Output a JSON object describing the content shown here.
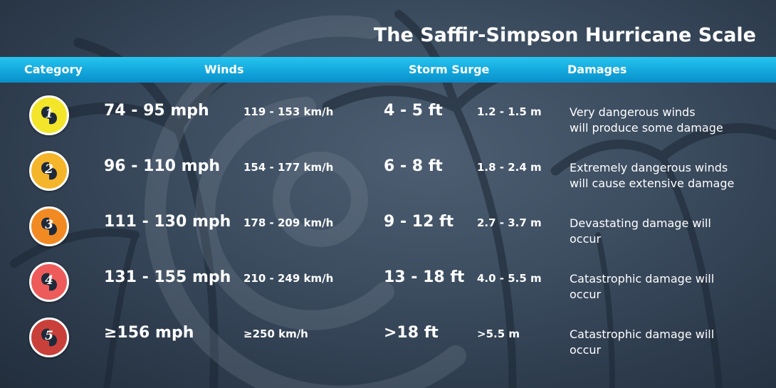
{
  "title": "The Saffir-Simpson Hurricane Scale",
  "headers": {
    "category": "Category",
    "winds": "Winds",
    "storm_surge": "Storm Surge",
    "damages": "Damages"
  },
  "rows": [
    {
      "category": "1",
      "badge_color": "#f3e62a",
      "winds_mph": "74 - 95 mph",
      "winds_kmh": "119 - 153 km/h",
      "surge_ft": "4 - 5 ft",
      "surge_m": "1.2 - 1.5 m",
      "damage_line1": "Very dangerous winds",
      "damage_line2": "will produce some damage"
    },
    {
      "category": "2",
      "badge_color": "#f5b52a",
      "winds_mph": "96 - 110 mph",
      "winds_kmh": "154 - 177 km/h",
      "surge_ft": "6 - 8 ft",
      "surge_m": "1.8 - 2.4 m",
      "damage_line1": "Extremely  dangerous winds",
      "damage_line2": "will cause extensive damage"
    },
    {
      "category": "3",
      "badge_color": "#f28a23",
      "winds_mph": "111 - 130 mph",
      "winds_kmh": "178 - 209 km/h",
      "surge_ft": "9 - 12 ft",
      "surge_m": "2.7 - 3.7 m",
      "damage_line1": "Devastating  damage will",
      "damage_line2": "occur"
    },
    {
      "category": "4",
      "badge_color": "#ee5b5b",
      "winds_mph": "131 - 155 mph",
      "winds_kmh": "210 - 249 km/h",
      "surge_ft": "13 - 18 ft",
      "surge_m": "4.0 - 5.5 m",
      "damage_line1": "Catastrophic damage will",
      "damage_line2": "occur"
    },
    {
      "category": "5",
      "badge_color": "#c9403a",
      "winds_mph": "≥156 mph",
      "winds_kmh": "≥250 km/h",
      "surge_ft": ">18 ft",
      "surge_m": ">5.5 m",
      "damage_line1": "Catastrophic damage will",
      "damage_line2": "occur"
    }
  ],
  "icons": {
    "badge_icon": "hurricane-symbol-icon",
    "background_icon": "hurricane-spiral-icon"
  }
}
